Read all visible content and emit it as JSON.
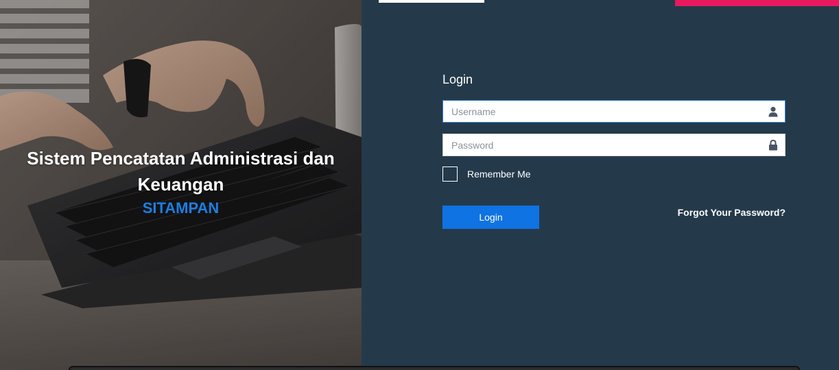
{
  "hero": {
    "title": "Sistem Pencatatan Administrasi dan Keuangan",
    "subtitle": "SITAMPAN"
  },
  "login": {
    "title": "Login",
    "username_placeholder": "Username",
    "password_placeholder": "Password",
    "remember_label": "Remember Me",
    "submit_label": "Login",
    "forgot_label": "Forgot Your Password?"
  },
  "icons": {
    "username": "user-icon",
    "password": "lock-icon"
  },
  "colors": {
    "panel_bg": "#243a4b",
    "accent_blue": "#0f73e3",
    "subtitle_blue": "#1a7fe3",
    "accent_pink": "#e8195e"
  }
}
